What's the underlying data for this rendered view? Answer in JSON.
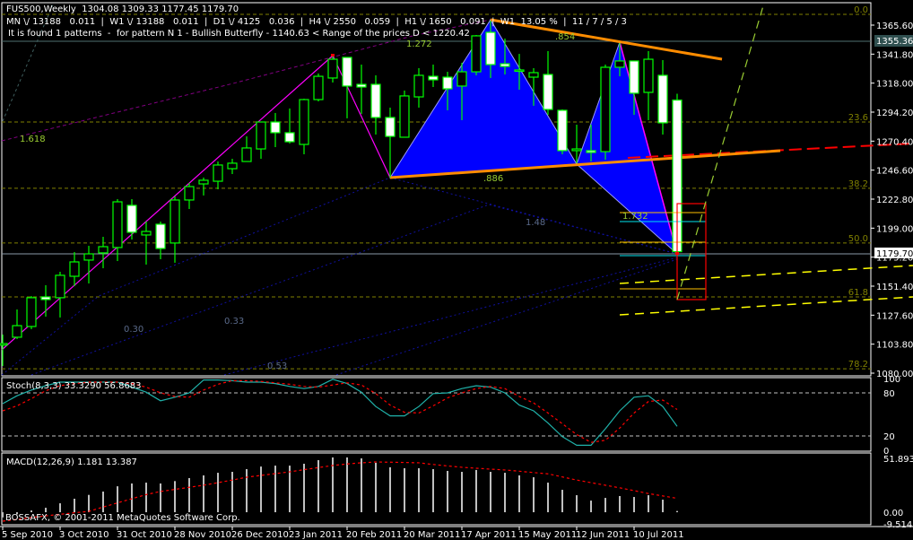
{
  "header": {
    "line1": "FUS500,Weekly  1304.08 1309.33 1177.45 1179.70",
    "line2": "MN \\/ 13188   0.011  |  W1 \\/ 13188   0.011  |  D1 \\/ 4125   0.036  |  H4 \\/ 2550   0.059  |  H1 \\/ 1650   0.091  |  W1  13.05 %  |  11 / 7 / 5 / 3",
    "line3": "It is found 1 patterns  -  for pattern N 1 - Bullish Butterfly - 1140.63 < Range of the prices D < 1220.42"
  },
  "annotations": {
    "r1618": "1.618",
    "r1272": "1.272",
    "r854": ".854",
    "r886": ".886",
    "r148": "1.48",
    "r1732": "1.732",
    "r030": "0.30",
    "r033": "0.33",
    "r053": "0.53"
  },
  "price_markers": {
    "upper": "1355.36",
    "current": "1179.70",
    "current_under": "1175.20"
  },
  "copyright": "BOSSAFX, © 2001-2011 MetaQuotes Software Corp.",
  "colors": {
    "bull_fill": "#000000",
    "bear_fill": "#ffffff",
    "candle_outline": "#00ff00",
    "pattern_fill": "#0000ff",
    "trend_orange": "#ff8c00",
    "stoch_main": "#20b2aa",
    "stoch_signal": "#ff0000",
    "macd_hist": "#c0c0c0",
    "macd_signal": "#ff0000",
    "fib_level": "#808000"
  },
  "chart_data": [
    {
      "type": "candlestick",
      "title": "FUS500,Weekly",
      "ylim": [
        1077.8,
        1384.0
      ],
      "yticks": [
        1365.6,
        1341.8,
        1318.0,
        1294.2,
        1270.4,
        1246.6,
        1222.8,
        1199.0,
        1175.2,
        1151.4,
        1127.6,
        1103.8,
        1080.0
      ],
      "ytick_labels": [
        "1365.60",
        "1341.80",
        "1318.00",
        "1294.20",
        "1270.40",
        "1246.60",
        "1222.80",
        "1199.00",
        "1175.20",
        "1151.40",
        "1127.60",
        "1103.80",
        "1080.00"
      ],
      "xticks": [
        {
          "index": 0,
          "label": "5 Sep 2010"
        },
        {
          "index": 4,
          "label": "3 Oct 2010"
        },
        {
          "index": 8,
          "label": "31 Oct 2010"
        },
        {
          "index": 12,
          "label": "28 Nov 2010"
        },
        {
          "index": 16,
          "label": "26 Dec 2010"
        },
        {
          "index": 20,
          "label": "23 Jan 2011"
        },
        {
          "index": 24,
          "label": "20 Feb 2011"
        },
        {
          "index": 28,
          "label": "20 Mar 2011"
        },
        {
          "index": 32,
          "label": "17 Apr 2011"
        },
        {
          "index": 36,
          "label": "15 May 2011"
        },
        {
          "index": 40,
          "label": "12 Jun 2011"
        },
        {
          "index": 44,
          "label": "10 Jul 2011"
        }
      ],
      "fib_levels": [
        {
          "label": "0.0",
          "price": 1374.4
        },
        {
          "label": "23.6",
          "price": 1286.1
        },
        {
          "label": "38.2",
          "price": 1231.7
        },
        {
          "label": "50.0",
          "price": 1186.8
        },
        {
          "label": "61.8",
          "price": 1142.6
        },
        {
          "label": "78.2",
          "price": 1083.6
        }
      ],
      "ohlc": [
        [
          1103.0,
          1111.7,
          1085.9,
          1104.3
        ],
        [
          1109.5,
          1132.3,
          1108.0,
          1119.0
        ],
        [
          1118.3,
          1143.3,
          1116.1,
          1141.9
        ],
        [
          1142.6,
          1152.2,
          1126.4,
          1140.4
        ],
        [
          1141.9,
          1163.2,
          1125.7,
          1160.3
        ],
        [
          1159.5,
          1179.4,
          1151.4,
          1171.3
        ],
        [
          1172.8,
          1184.5,
          1153.6,
          1177.9
        ],
        [
          1178.7,
          1191.9,
          1166.1,
          1183.8
        ],
        [
          1183.1,
          1222.8,
          1172.0,
          1220.6
        ],
        [
          1217.7,
          1222.8,
          1189.7,
          1195.6
        ],
        [
          1193.4,
          1204.4,
          1169.1,
          1196.3
        ],
        [
          1202.2,
          1204.4,
          1173.5,
          1182.3
        ],
        [
          1186.8,
          1225.0,
          1170.6,
          1222.1
        ],
        [
          1222.1,
          1236.1,
          1214.7,
          1233.1
        ],
        [
          1235.3,
          1240.5,
          1225.8,
          1238.3
        ],
        [
          1237.5,
          1253.7,
          1230.9,
          1250.8
        ],
        [
          1247.8,
          1255.9,
          1243.4,
          1252.3
        ],
        [
          1253.7,
          1274.3,
          1253.7,
          1264.8
        ],
        [
          1264.0,
          1286.1,
          1255.9,
          1286.1
        ],
        [
          1286.1,
          1293.5,
          1265.5,
          1277.3
        ],
        [
          1277.3,
          1297.2,
          1268.4,
          1269.9
        ],
        [
          1267.7,
          1305.2,
          1259.6,
          1304.5
        ],
        [
          1304.5,
          1325.9,
          1303.0,
          1323.6
        ],
        [
          1322.2,
          1340.6,
          1318.5,
          1337.6
        ],
        [
          1339.1,
          1339.1,
          1289.1,
          1315.6
        ],
        [
          1317.0,
          1333.2,
          1292.7,
          1314.8
        ],
        [
          1317.0,
          1324.4,
          1275.8,
          1289.8
        ],
        [
          1289.8,
          1297.9,
          1240.5,
          1274.3
        ],
        [
          1273.6,
          1311.9,
          1273.6,
          1307.5
        ],
        [
          1306.7,
          1330.3,
          1297.9,
          1324.4
        ],
        [
          1323.6,
          1333.2,
          1314.8,
          1320.7
        ],
        [
          1322.9,
          1327.3,
          1295.7,
          1313.3
        ],
        [
          1315.6,
          1334.7,
          1287.6,
          1327.3
        ],
        [
          1327.3,
          1357.5,
          1324.4,
          1356.8
        ],
        [
          1359.7,
          1369.3,
          1322.2,
          1333.2
        ],
        [
          1333.9,
          1354.6,
          1325.1,
          1331.7
        ],
        [
          1328.1,
          1342.0,
          1312.6,
          1328.8
        ],
        [
          1322.9,
          1330.3,
          1299.4,
          1326.6
        ],
        [
          1325.1,
          1344.3,
          1292.0,
          1296.4
        ],
        [
          1295.7,
          1296.4,
          1259.6,
          1262.6
        ],
        [
          1262.6,
          1283.9,
          1252.3,
          1264.0
        ],
        [
          1262.6,
          1283.9,
          1253.7,
          1261.1
        ],
        [
          1261.8,
          1333.2,
          1255.2,
          1331.0
        ],
        [
          1331.0,
          1350.9,
          1323.6,
          1336.2
        ],
        [
          1336.2,
          1336.2,
          1292.0,
          1309.7
        ],
        [
          1310.4,
          1344.3,
          1287.6,
          1337.6
        ],
        [
          1324.4,
          1336.9,
          1275.8,
          1285.4
        ],
        [
          1304.08,
          1309.33,
          1177.45,
          1179.7
        ]
      ]
    },
    {
      "type": "line",
      "title": "Stoch(8,3,3) 33.3290 56.8683",
      "ylim": [
        0,
        100
      ],
      "levels": [
        20,
        80
      ],
      "yticks": [
        100,
        80,
        20,
        0
      ],
      "ytick_labels": [
        "100",
        "80",
        "20",
        "0"
      ],
      "series": [
        {
          "name": "Main",
          "values": [
            65,
            76,
            84,
            90,
            95,
            95,
            95,
            95,
            95,
            88,
            81,
            69,
            74,
            80,
            98,
            98,
            97,
            95,
            95,
            93,
            89,
            86,
            89,
            99,
            93,
            81,
            61,
            48,
            48,
            61,
            79,
            80,
            86,
            90,
            88,
            80,
            63,
            55,
            38,
            19,
            7,
            7,
            30,
            55,
            74,
            76,
            61,
            33.33
          ]
        },
        {
          "name": "Signal",
          "values": [
            55,
            62,
            72,
            83,
            90,
            93,
            95,
            95,
            95,
            93,
            88,
            80,
            75,
            74,
            84,
            92,
            97,
            97,
            96,
            94,
            92,
            89,
            88,
            91,
            94,
            91,
            79,
            63,
            53,
            52,
            62,
            73,
            80,
            86,
            89,
            86,
            75,
            66,
            52,
            37,
            22,
            11,
            14,
            31,
            52,
            68,
            70,
            56.87
          ]
        }
      ]
    },
    {
      "type": "bar",
      "title": "MACD(12,26,9) 1.181 13.387",
      "ylim": [
        -11.2,
        56.2
      ],
      "yticks": [
        51.893,
        0,
        -9.514
      ],
      "ytick_labels": [
        "51.893",
        "0.00",
        "-9.514"
      ],
      "series": [
        {
          "name": "MACD",
          "values": [
            -5,
            -2,
            1.7,
            4.3,
            8.6,
            13,
            16.7,
            19.9,
            25,
            27.7,
            28.5,
            27.7,
            30,
            32.9,
            35.5,
            38,
            38.9,
            41.5,
            44,
            44.9,
            44.9,
            46.7,
            50.2,
            52.8,
            52.8,
            51.9,
            47.6,
            43.3,
            42.4,
            42.4,
            41.5,
            39.8,
            38.9,
            40.7,
            38.9,
            38,
            35.5,
            33.7,
            28.5,
            21.6,
            16.4,
            11.2,
            13.8,
            15.6,
            14.7,
            16.4,
            12.1,
            1.181
          ]
        },
        {
          "name": "Signal",
          "values": [
            -8.6,
            -7,
            -5,
            -3.5,
            -2,
            -0.5,
            0.8,
            5,
            9,
            13,
            17,
            20,
            22,
            24,
            26,
            28.5,
            31,
            33.7,
            35.5,
            37.2,
            38.9,
            41,
            43,
            45,
            46.5,
            47.6,
            48.4,
            48.2,
            47.9,
            47.6,
            46,
            44.6,
            43.3,
            42.4,
            41.5,
            40.7,
            39.5,
            38.2,
            37,
            34,
            31,
            28.5,
            26,
            23.5,
            20.8,
            18,
            15.7,
            13.387
          ]
        }
      ]
    }
  ]
}
